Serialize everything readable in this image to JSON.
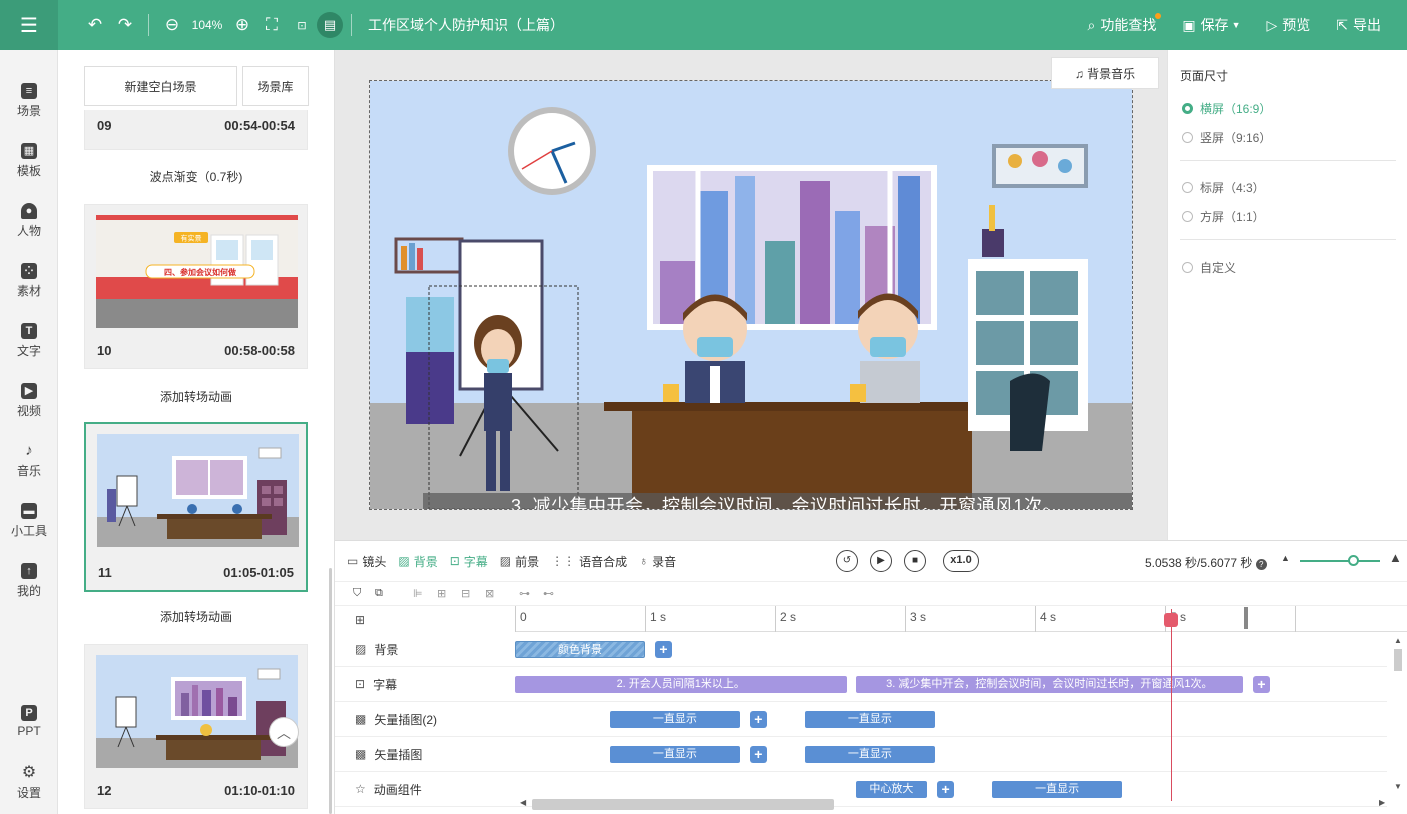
{
  "topbar": {
    "zoom": "104%",
    "title": "工作区域个人防护知识（上篇）",
    "search_label": "功能查找",
    "save_label": "保存",
    "preview_label": "预览",
    "export_label": "导出"
  },
  "sidenav": {
    "items": [
      {
        "label": "场景",
        "icon": "scene-icon"
      },
      {
        "label": "模板",
        "icon": "template-icon"
      },
      {
        "label": "人物",
        "icon": "person-icon"
      },
      {
        "label": "素材",
        "icon": "material-icon"
      },
      {
        "label": "文字",
        "icon": "text-icon"
      },
      {
        "label": "视频",
        "icon": "video-icon"
      },
      {
        "label": "音乐",
        "icon": "music-icon"
      },
      {
        "label": "小工具",
        "icon": "toolbox-icon"
      },
      {
        "label": "我的",
        "icon": "mine-icon"
      },
      {
        "label": "PPT",
        "icon": "ppt-icon"
      },
      {
        "label": "设置",
        "icon": "settings-icon"
      }
    ]
  },
  "scenes": {
    "new_label": "新建空白场景",
    "library_label": "场景库",
    "cards": [
      {
        "num": "09",
        "time": "00:54-00:54",
        "transition": "波点渐变（0.7秒)"
      },
      {
        "num": "10",
        "time": "00:58-00:58",
        "transition": "添加转场动画"
      },
      {
        "num": "11",
        "time": "01:05-01:05",
        "transition": "添加转场动画"
      },
      {
        "num": "12",
        "time": "01:10-01:10"
      }
    ],
    "thumb10_sign": "有实景",
    "thumb10_banner": "四、参加会议如何做"
  },
  "canvas": {
    "bgm_label": "背景音乐",
    "subtitle": "3. 减少集中开会，控制会议时间，会议时间过长时，开窗通风1次。"
  },
  "right_panel": {
    "title": "页面尺寸",
    "options": [
      {
        "label": "横屏（16:9）",
        "selected": true
      },
      {
        "label": "竖屏（9:16）",
        "selected": false
      },
      {
        "label": "标屏（4:3）",
        "selected": false
      },
      {
        "label": "方屏（1:1）",
        "selected": false
      },
      {
        "label": "自定义",
        "selected": false
      }
    ]
  },
  "timeline": {
    "tabs": [
      "镜头",
      "背景",
      "字幕",
      "前景",
      "语音合成",
      "录音"
    ],
    "speed": "x1.0",
    "time_readout": "5.0538 秒/5.6077 秒",
    "ruler": [
      "0",
      "1 s",
      "2 s",
      "3 s",
      "4 s",
      "5 s"
    ],
    "playhead_seconds": 5.0538,
    "rows": [
      {
        "label": "背景",
        "icon": "background-icon",
        "clips": [
          {
            "text": "颜色背景",
            "start": 0,
            "end": 1.0
          }
        ]
      },
      {
        "label": "字幕",
        "icon": "subtitle-icon",
        "clips": [
          {
            "text": "2. 开会人员间隔1米以上。",
            "start": 0,
            "end": 2.55
          },
          {
            "text": "3. 减少集中开会，控制会议时间，会议时间过长时，开窗通风1次。",
            "start": 2.62,
            "end": 5.6
          }
        ]
      },
      {
        "label": "矢量插图(2)",
        "icon": "vector-icon",
        "clips": [
          {
            "text": "一直显示",
            "start": 0.73,
            "end": 1.73
          },
          {
            "text": "一直显示",
            "start": 2.23,
            "end": 3.23
          }
        ]
      },
      {
        "label": "矢量插图",
        "icon": "vector-icon",
        "clips": [
          {
            "text": "一直显示",
            "start": 0.73,
            "end": 1.73
          },
          {
            "text": "一直显示",
            "start": 2.23,
            "end": 3.23
          }
        ]
      },
      {
        "label": "动画组件",
        "icon": "animation-icon",
        "clips": [
          {
            "text": "中心放大",
            "start": 2.62,
            "end": 3.17
          },
          {
            "text": "一直显示",
            "start": 3.67,
            "end": 4.67
          }
        ]
      }
    ]
  },
  "colors": {
    "brand": "#44ad86",
    "subtitle_clip": "#a596e1",
    "element_clip": "#5a8fd4",
    "playhead": "#d94b5e"
  }
}
